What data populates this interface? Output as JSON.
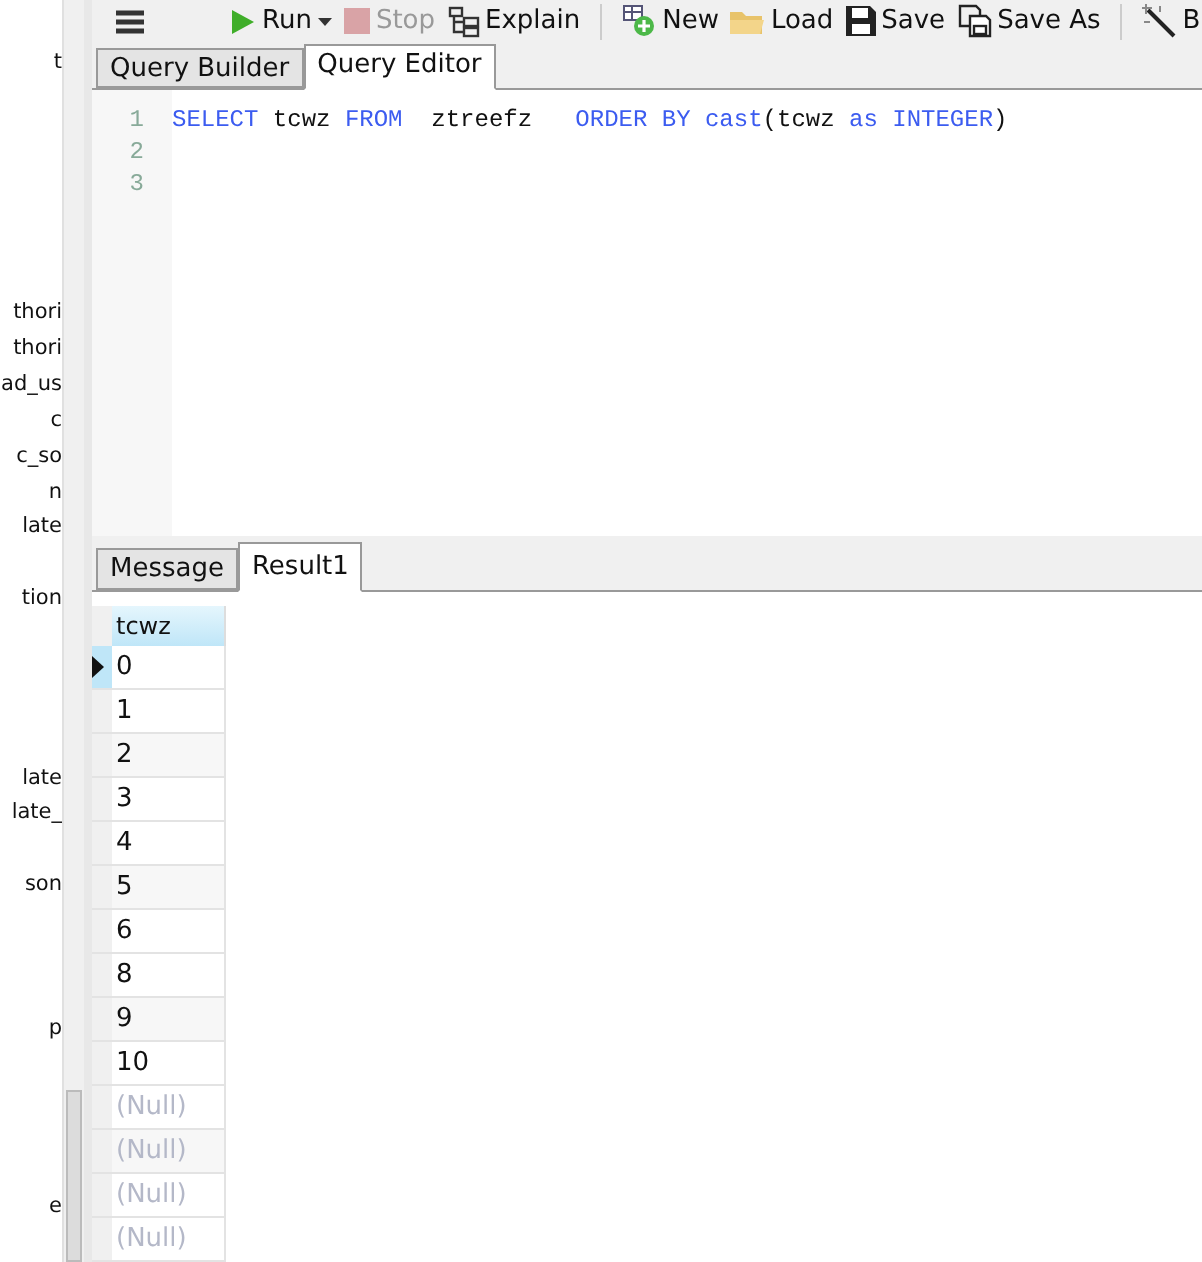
{
  "sidebar": {
    "items": [
      "t",
      "thori",
      "thori",
      "ad_us",
      "c",
      "c_so",
      "n",
      "late",
      "tion",
      "late",
      "late_",
      "son",
      "p",
      "e"
    ]
  },
  "toolbar": {
    "items": [
      {
        "kind": "run",
        "label": "Run",
        "disabled": false
      },
      {
        "kind": "stop",
        "label": "Stop",
        "disabled": true
      },
      {
        "kind": "explain",
        "label": "Explain",
        "disabled": false
      },
      {
        "kind": "new",
        "label": "New",
        "disabled": false
      },
      {
        "kind": "load",
        "label": "Load",
        "disabled": false
      },
      {
        "kind": "save",
        "label": "Save",
        "disabled": false
      },
      {
        "kind": "saveas",
        "label": "Save As",
        "disabled": false
      },
      {
        "kind": "beautify",
        "label": "B",
        "disabled": false
      }
    ]
  },
  "editor_tabs": [
    {
      "label": "Query Builder",
      "selected": false
    },
    {
      "label": "Query Editor",
      "selected": true
    }
  ],
  "editor": {
    "lines": [
      {
        "number": "1",
        "tokens": [
          {
            "kind": "keyword",
            "text": "SELECT"
          },
          {
            "kind": "plain",
            "text": " tcwz "
          },
          {
            "kind": "keyword",
            "text": "FROM"
          },
          {
            "kind": "plain",
            "text": "  ztreefz   "
          },
          {
            "kind": "keyword",
            "text": "ORDER BY cast"
          },
          {
            "kind": "plain",
            "text": "(tcwz "
          },
          {
            "kind": "keyword",
            "text": "as INTEGER"
          },
          {
            "kind": "plain",
            "text": ")"
          }
        ]
      },
      {
        "number": "2"
      },
      {
        "number": "3"
      }
    ]
  },
  "result_tabs": [
    {
      "label": "Message",
      "selected": false
    },
    {
      "label": "Result1",
      "selected": true
    }
  ],
  "table": {
    "columns": [
      "tcwz"
    ],
    "rows": [
      {
        "value": "0",
        "is_null": false,
        "current": true
      },
      {
        "value": "1",
        "is_null": false,
        "current": false
      },
      {
        "value": "2",
        "is_null": false,
        "current": false
      },
      {
        "value": "3",
        "is_null": false,
        "current": false
      },
      {
        "value": "4",
        "is_null": false,
        "current": false
      },
      {
        "value": "5",
        "is_null": false,
        "current": false
      },
      {
        "value": "6",
        "is_null": false,
        "current": false
      },
      {
        "value": "8",
        "is_null": false,
        "current": false
      },
      {
        "value": "9",
        "is_null": false,
        "current": false
      },
      {
        "value": "10",
        "is_null": false,
        "current": false
      },
      {
        "value": "(Null)",
        "is_null": true,
        "current": false
      },
      {
        "value": "(Null)",
        "is_null": true,
        "current": false
      },
      {
        "value": "(Null)",
        "is_null": true,
        "current": false
      },
      {
        "value": "(Null)",
        "is_null": true,
        "current": false
      }
    ]
  }
}
